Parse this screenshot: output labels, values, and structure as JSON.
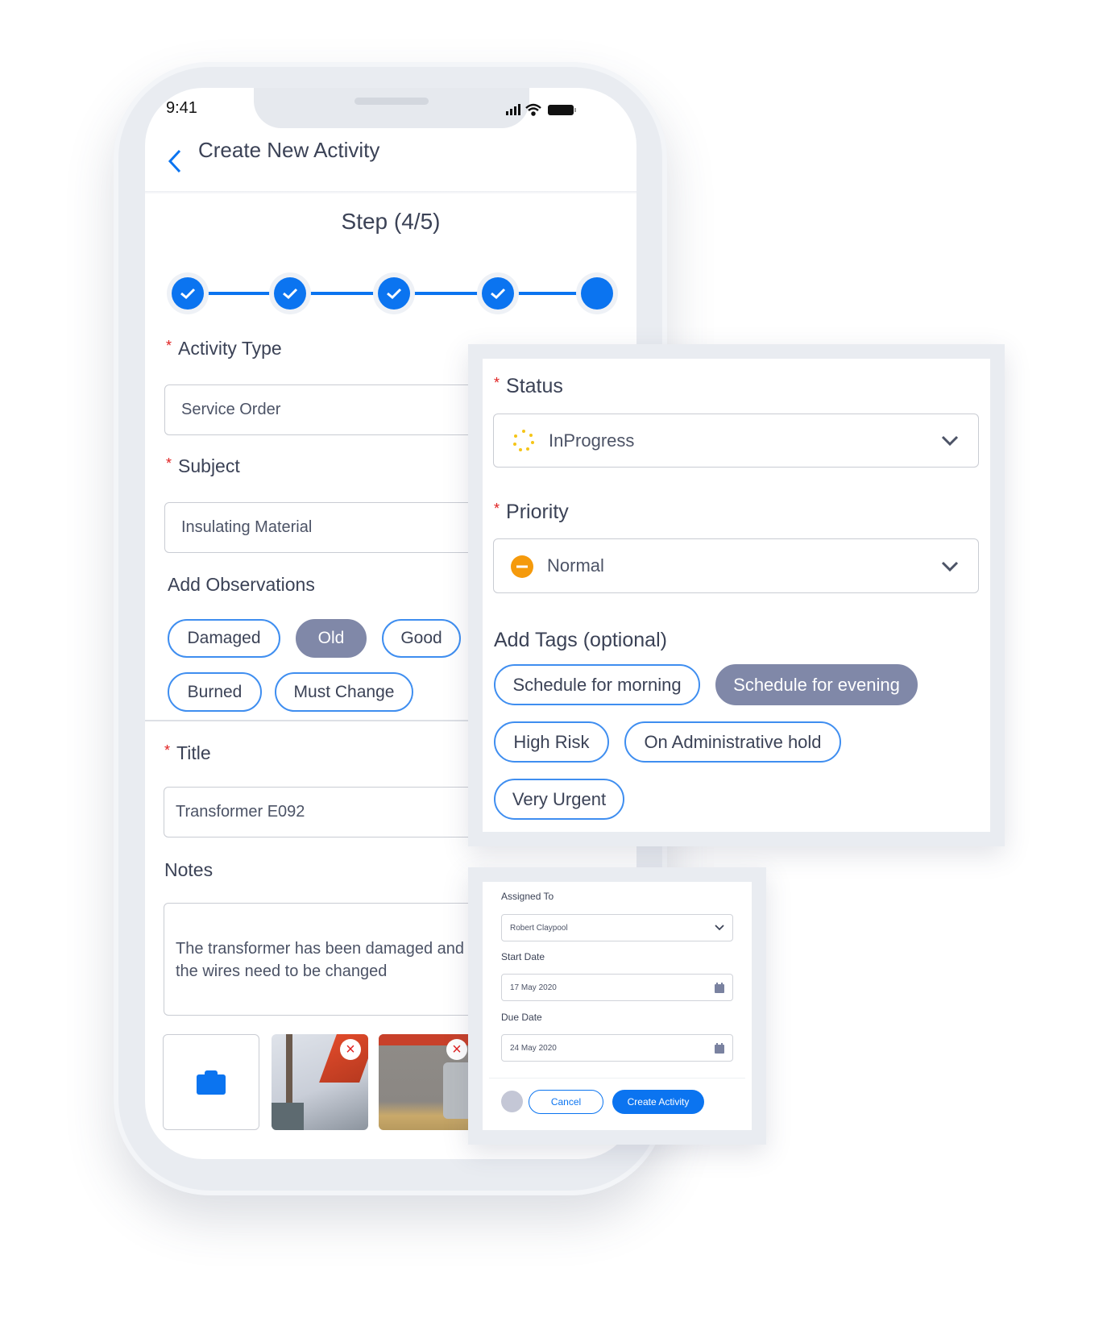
{
  "status_bar": {
    "time": "9:41"
  },
  "header": {
    "title": "Create New Activity"
  },
  "step": {
    "label": "Step (4/5)",
    "current": 4,
    "total": 5
  },
  "form": {
    "activity_type": {
      "label": "Activity Type",
      "value": "Service Order"
    },
    "subject": {
      "label": "Subject",
      "value": "Insulating Material"
    },
    "observations": {
      "label": "Add Observations",
      "chips": [
        {
          "label": "Damaged",
          "selected": false
        },
        {
          "label": "Old",
          "selected": true
        },
        {
          "label": "Good",
          "selected": false
        },
        {
          "label": "Burned",
          "selected": false
        },
        {
          "label": "Must Change",
          "selected": false
        }
      ]
    },
    "title": {
      "label": "Title",
      "value": "Transformer E092"
    },
    "notes": {
      "label": "Notes",
      "value": "The transformer has been damaged and the wires need to be changed"
    }
  },
  "status_panel": {
    "status": {
      "label": "Status",
      "value": "InProgress",
      "icon": "spinner-icon",
      "icon_color": "#f5c518"
    },
    "priority": {
      "label": "Priority",
      "value": "Normal",
      "icon": "minus-circle-icon",
      "icon_color": "#f59a0c"
    },
    "tags": {
      "label": "Add Tags (optional)",
      "items": [
        {
          "label": "Schedule for morning",
          "selected": false
        },
        {
          "label": "Schedule for evening",
          "selected": true
        },
        {
          "label": "High Risk",
          "selected": false
        },
        {
          "label": "On Administrative hold",
          "selected": false
        },
        {
          "label": "Very Urgent",
          "selected": false
        }
      ]
    }
  },
  "assign_panel": {
    "assigned_to": {
      "label": "Assigned To",
      "value": "Robert Claypool"
    },
    "start_date": {
      "label": "Start Date",
      "value": "17 May 2020"
    },
    "due_date": {
      "label": "Due Date",
      "value": "24 May 2020"
    },
    "cancel": "Cancel",
    "create": "Create Activity"
  },
  "colors": {
    "accent": "#0b74f0",
    "selected_chip": "#8088a8",
    "required": "#e02020"
  }
}
